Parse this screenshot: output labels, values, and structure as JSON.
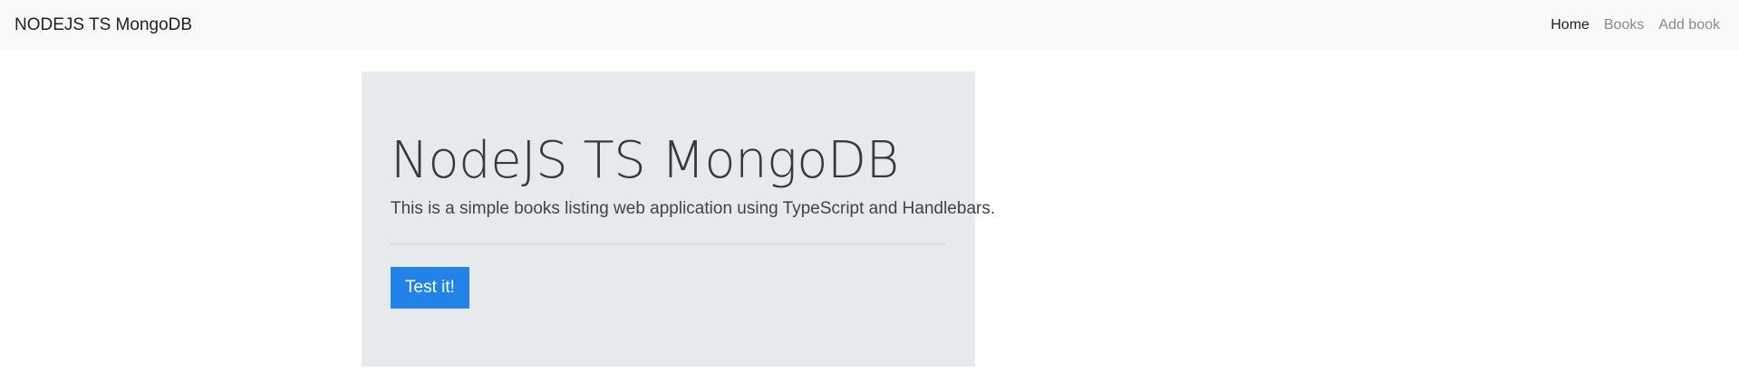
{
  "navbar": {
    "brand": "NODEJS TS MongoDB",
    "links": [
      {
        "label": "Home",
        "active": true
      },
      {
        "label": "Books",
        "active": false
      },
      {
        "label": "Add book",
        "active": false
      }
    ]
  },
  "jumbotron": {
    "title": "NodeJS TS MongoDB",
    "lead": "This is a simple books listing web application using TypeScript and Handlebars.",
    "button_label": "Test it!"
  },
  "colors": {
    "navbar_bg": "#f8f9fa",
    "jumbotron_bg": "#e6eaed",
    "button_bg": "#2183e8"
  }
}
